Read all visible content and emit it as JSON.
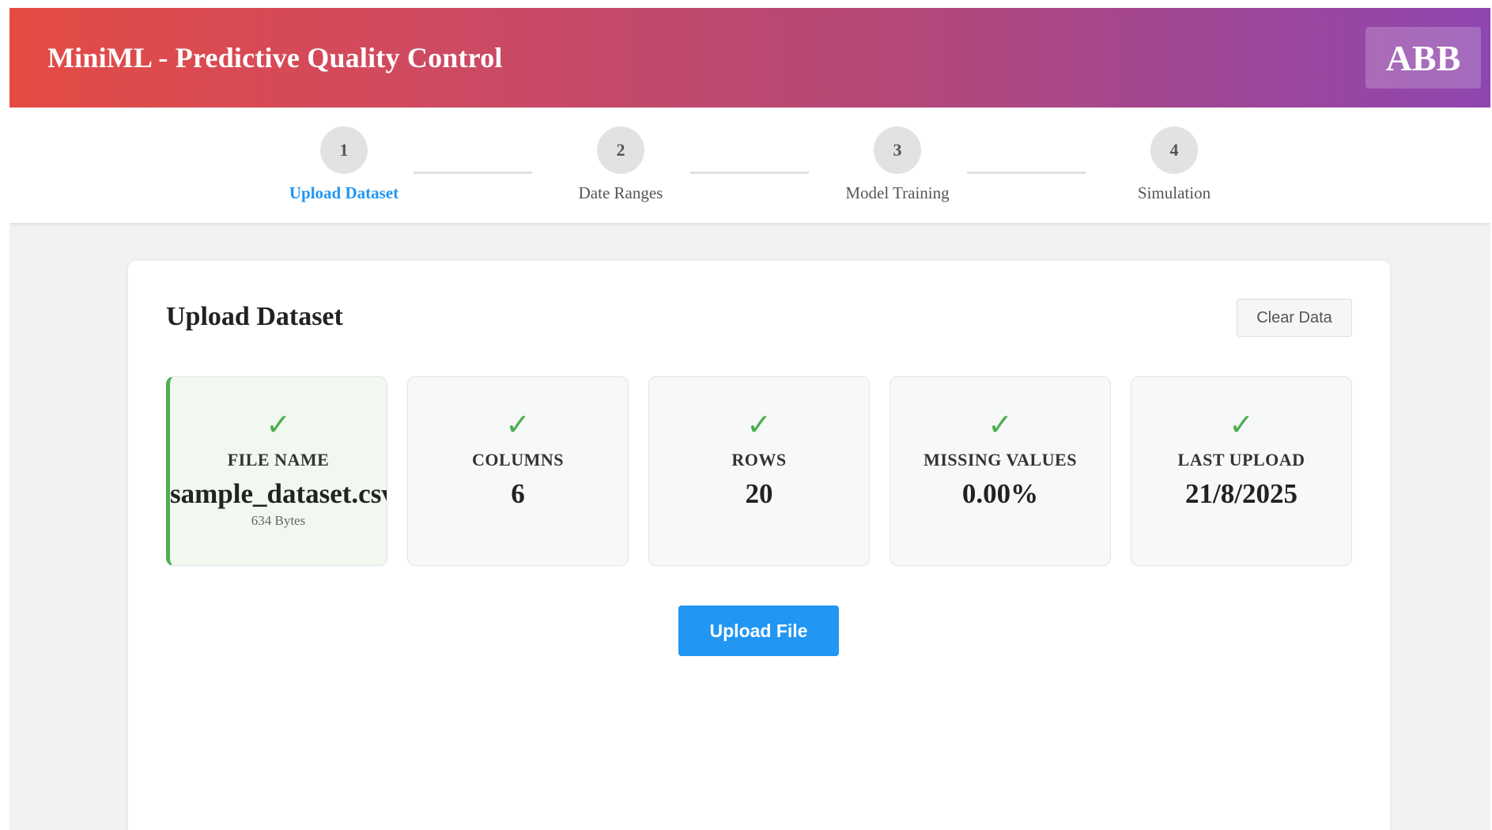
{
  "header": {
    "title": "MiniML - Predictive Quality Control",
    "brand": "ABB"
  },
  "steps": [
    {
      "number": "1",
      "label": "Upload Dataset",
      "active": true
    },
    {
      "number": "2",
      "label": "Date Ranges",
      "active": false
    },
    {
      "number": "3",
      "label": "Model Training",
      "active": false
    },
    {
      "number": "4",
      "label": "Simulation",
      "active": false
    }
  ],
  "main": {
    "title": "Upload Dataset",
    "clear_label": "Clear Data",
    "upload_label": "Upload File"
  },
  "stats": [
    {
      "icon": "check-icon",
      "label": "FILE NAME",
      "value": "sample_dataset.csv",
      "sub": "634 Bytes"
    },
    {
      "icon": "check-icon",
      "label": "COLUMNS",
      "value": "6"
    },
    {
      "icon": "check-icon",
      "label": "ROWS",
      "value": "20"
    },
    {
      "icon": "check-icon",
      "label": "MISSING VALUES",
      "value": "0.00%"
    },
    {
      "icon": "check-icon",
      "label": "LAST UPLOAD",
      "value": "21/8/2025"
    }
  ],
  "colors": {
    "accent": "#2196f3",
    "success": "#4caf50",
    "header_start": "#e44b44",
    "header_end": "#8e46b0"
  }
}
